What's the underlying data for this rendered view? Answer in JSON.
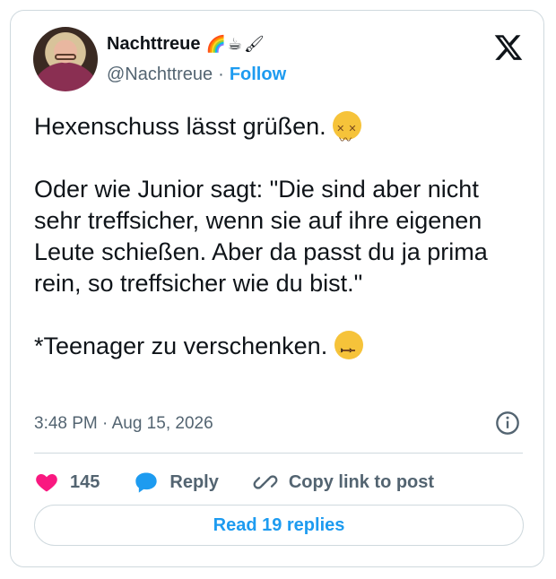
{
  "user": {
    "display_name": "Nachttreue",
    "name_emojis": "🌈☕🖌",
    "handle": "@Nachttreue",
    "separator": "·",
    "follow_label": "Follow"
  },
  "tweet": {
    "line1": "Hexenschuss lässt grüßen.",
    "paragraph2": "Oder wie Junior sagt: \"Die sind aber nicht sehr treffsicher, wenn sie auf ihre eigenen Leute schießen. Aber da passt du ja prima rein, so treffsicher wie du bist.\"",
    "line3": "*Teenager zu verschenken.",
    "timestamp": "3:48 PM · Aug 15, 2026"
  },
  "actions": {
    "like_count": "145",
    "reply_label": "Reply",
    "copy_label": "Copy link to post",
    "read_replies_label": "Read 19 replies"
  },
  "colors": {
    "accent": "#1d9bf0",
    "like": "#f91880",
    "muted": "#536471",
    "border": "#cfd9de"
  },
  "icons": [
    "x-logo-icon",
    "info-icon",
    "heart-icon",
    "reply-bubble-icon",
    "link-icon",
    "tired-face-emoji",
    "eye-roll-face-emoji"
  ]
}
